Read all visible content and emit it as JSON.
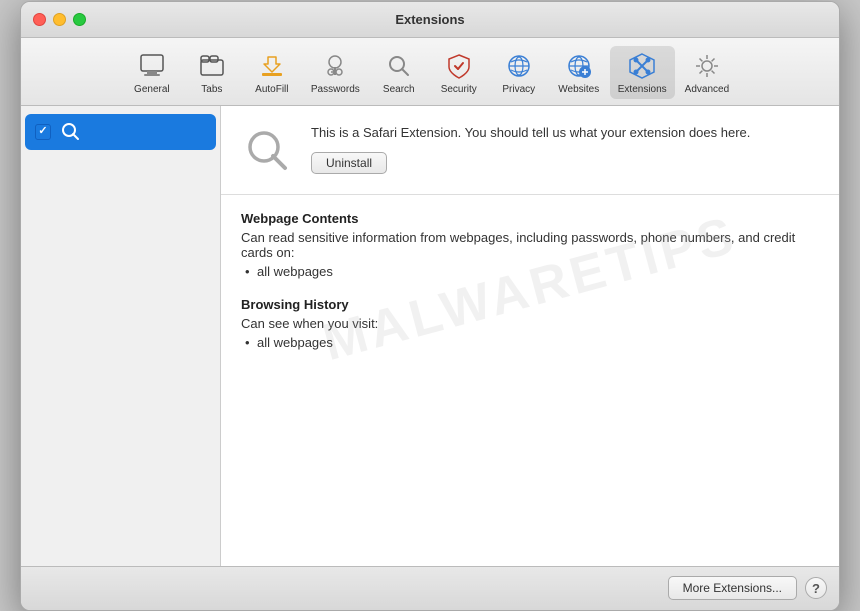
{
  "window": {
    "title": "Extensions"
  },
  "toolbar": {
    "items": [
      {
        "id": "general",
        "label": "General",
        "icon": "general"
      },
      {
        "id": "tabs",
        "label": "Tabs",
        "icon": "tabs"
      },
      {
        "id": "autofill",
        "label": "AutoFill",
        "icon": "autofill"
      },
      {
        "id": "passwords",
        "label": "Passwords",
        "icon": "passwords"
      },
      {
        "id": "search",
        "label": "Search",
        "icon": "search"
      },
      {
        "id": "security",
        "label": "Security",
        "icon": "security"
      },
      {
        "id": "privacy",
        "label": "Privacy",
        "icon": "privacy"
      },
      {
        "id": "websites",
        "label": "Websites",
        "icon": "websites"
      },
      {
        "id": "extensions",
        "label": "Extensions",
        "icon": "extensions",
        "active": true
      },
      {
        "id": "advanced",
        "label": "Advanced",
        "icon": "advanced"
      }
    ]
  },
  "sidebar": {
    "items": [
      {
        "id": "search-ext",
        "label": "",
        "checked": true,
        "selected": true
      }
    ]
  },
  "detail": {
    "description": "This is a Safari Extension. You should tell us what your extension does here.",
    "uninstall_label": "Uninstall",
    "permissions": [
      {
        "title": "Webpage Contents",
        "description": "Can read sensitive information from webpages, including passwords, phone numbers, and credit cards on:",
        "items": [
          "all webpages"
        ]
      },
      {
        "title": "Browsing History",
        "description": "Can see when you visit:",
        "items": [
          "all webpages"
        ]
      }
    ]
  },
  "footer": {
    "more_extensions_label": "More Extensions...",
    "help_label": "?"
  },
  "watermark": {
    "text": "MALWARETIPS"
  }
}
